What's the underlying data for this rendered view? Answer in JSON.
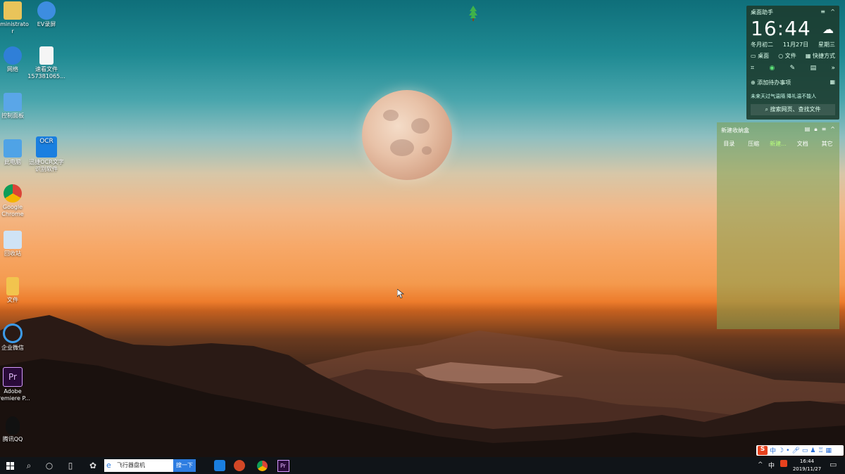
{
  "desktop_icons": [
    {
      "label": "dministrato\nr",
      "icon": "user-folder-icon"
    },
    {
      "label": "EV录屏",
      "icon": "ev-recorder-icon"
    },
    {
      "label": "网络",
      "icon": "network-icon"
    },
    {
      "label": "速看文件\n157381065...",
      "icon": "document-icon"
    },
    {
      "label": "控制面板",
      "icon": "control-panel-icon"
    },
    {
      "label": "此电脑",
      "icon": "computer-icon"
    },
    {
      "label": "OCR",
      "icon": "ocr-icon"
    },
    {
      "label": "迅捷OCR文字\n识别软件",
      "icon": "ocr-app-label"
    },
    {
      "label": "Google\nChrome",
      "icon": "chrome-icon"
    },
    {
      "label": "回收站",
      "icon": "recycle-bin-icon"
    },
    {
      "label": "文件",
      "icon": "folder-icon"
    },
    {
      "label": "企业微信",
      "icon": "wecom-icon"
    },
    {
      "label": "Adobe\nPremiere P...",
      "icon": "premiere-icon"
    },
    {
      "label": "腾讯QQ",
      "icon": "qq-icon"
    }
  ],
  "widget": {
    "title": "桌面助手",
    "time": "16:44",
    "lunar": "冬月初二",
    "date": "11月27日",
    "weekday": "星期三",
    "links": [
      "桌面",
      "文件",
      "快捷方式"
    ],
    "todo": "添加待办事项",
    "weather_tip": "未来天过气温隔 降礼温不能人",
    "search": "搜索网页、查找文件"
  },
  "notes": {
    "title": "新建收纳盒",
    "tabs": [
      "目录",
      "压缩",
      "新建...",
      "文档",
      "其它"
    ]
  },
  "taskbar": {
    "search_placeholder": "飞行器盘机",
    "search_button": "搜一下",
    "tray_time": "16:44",
    "tray_date": "2019/11/27",
    "ime_lang": "中",
    "tray_lang": "中"
  },
  "colors": {
    "taskbar": "#101418",
    "search_button": "#2e7de1",
    "widget_bg": "#1c3a2c"
  }
}
